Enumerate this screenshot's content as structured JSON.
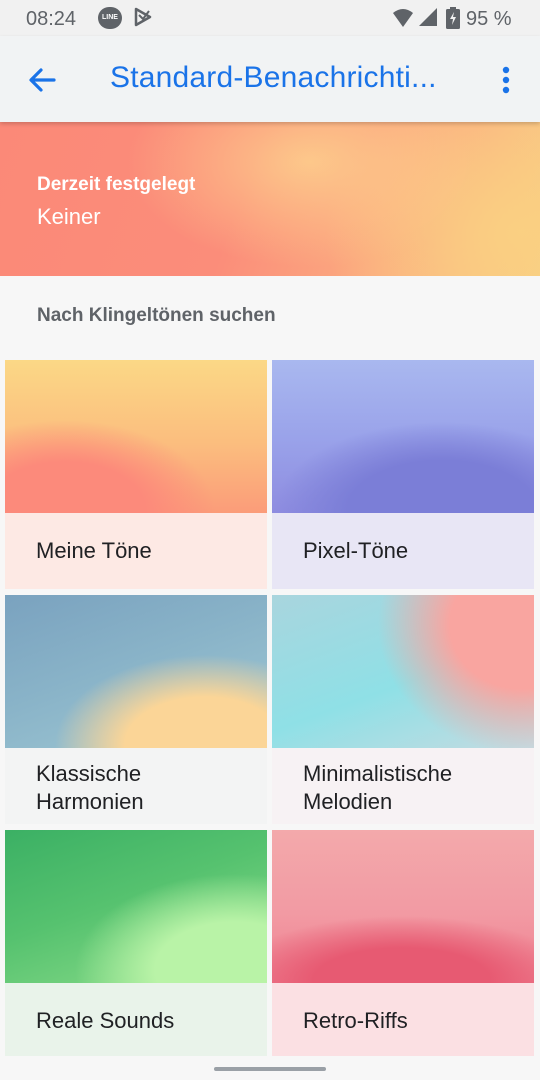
{
  "status_bar": {
    "time": "08:24",
    "battery": "95 %",
    "icons": [
      "line-icon",
      "play-store-icon",
      "wifi-icon",
      "signal-icon",
      "battery-charging-icon"
    ],
    "line_label": "LINE"
  },
  "app_bar": {
    "title": "Standard-Benachrichti...",
    "back_icon": "arrow-back-icon",
    "menu_icon": "more-vert-icon",
    "accent_color": "#1a73e8"
  },
  "current": {
    "label": "Derzeit festgelegt",
    "value": "Keiner"
  },
  "browse": {
    "title": "Nach Klingeltönen suchen",
    "categories": [
      {
        "label": "Meine Töne"
      },
      {
        "label": "Pixel-Töne"
      },
      {
        "label": "Klassische Harmonien"
      },
      {
        "label": "Minimalistische Melodien"
      },
      {
        "label": "Reale Sounds"
      },
      {
        "label": "Retro-Riffs"
      }
    ]
  }
}
